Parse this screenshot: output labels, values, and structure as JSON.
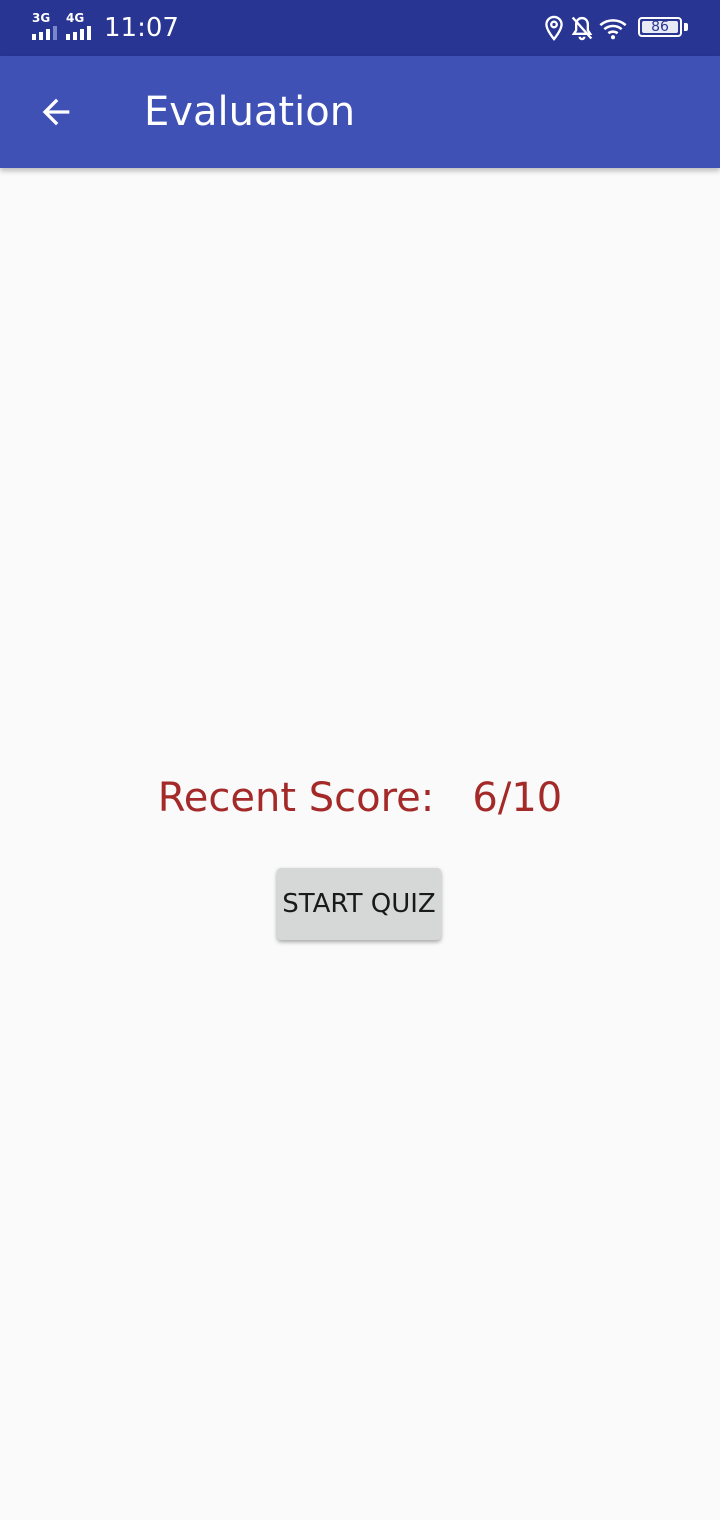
{
  "status_bar": {
    "network_1": "3G",
    "network_2": "4G",
    "time": "11:07",
    "battery_level": "86",
    "icons": [
      "signal-3g-icon",
      "signal-4g-icon",
      "location-icon",
      "notifications-off-icon",
      "wifi-icon",
      "battery-icon"
    ]
  },
  "app_bar": {
    "back_icon": "arrow-back-icon",
    "title": "Evaluation"
  },
  "main": {
    "score_label": "Recent Score:",
    "score_value": "6/10",
    "start_button_label": "START QUIZ"
  },
  "colors": {
    "status_bar": "#283593",
    "app_bar": "#3f51b5",
    "score_text": "#a42a29",
    "button_bg": "#d6d7d7",
    "background": "#fafafa"
  }
}
